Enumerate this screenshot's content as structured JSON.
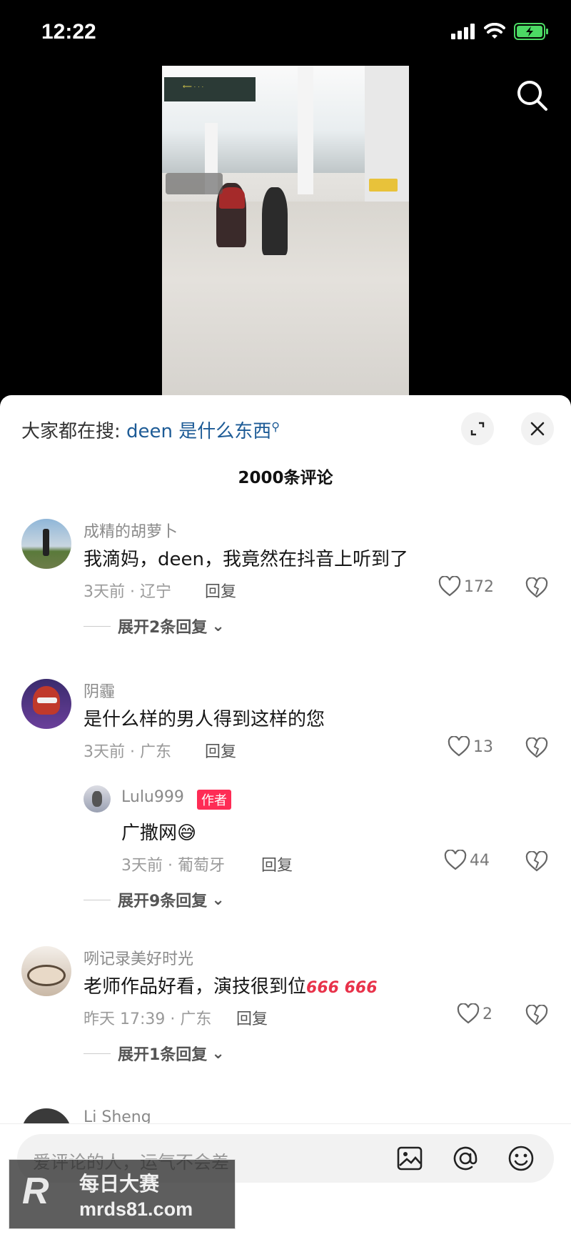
{
  "status": {
    "time": "12:22"
  },
  "trending": {
    "prefix": "大家都在搜: ",
    "query": "deen 是什么东西"
  },
  "comments_header": {
    "count_label": "2000条评论"
  },
  "comments": [
    {
      "username": "成精的胡萝卜",
      "text": "我滴妈，deen，我竟然在抖音上听到了",
      "meta": "3天前 · 辽宁",
      "reply": "回复",
      "likes": "172",
      "expand": "展开2条回复"
    },
    {
      "username": "阴霾",
      "text": "是什么样的男人得到这样的您",
      "meta": "3天前 · 广东",
      "reply": "回复",
      "likes": "13"
    },
    {
      "username": "Lulu999",
      "author_tag": "作者",
      "text": "广撒网😅",
      "meta": "3天前 · 葡萄牙",
      "reply": "回复",
      "likes": "44",
      "expand": "展开9条回复"
    },
    {
      "username": "咧记录美好时光",
      "text": "老师作品好看，演技很到位",
      "emoji": "666 666",
      "meta": "昨天 17:39 · 广东",
      "reply": "回复",
      "likes": "2",
      "expand": "展开1条回复"
    },
    {
      "username": "Li Sheng"
    }
  ],
  "input": {
    "placeholder": "爱评论的人，运气不会差"
  },
  "watermark": {
    "logo": "R",
    "title": "每日大赛",
    "url": "mrds81.com"
  },
  "colors": {
    "accent": "#fe2c55",
    "query": "#1d5b96"
  },
  "icons": [
    "search-icon",
    "expand-icon",
    "close-icon",
    "heart-icon",
    "broken-heart-icon",
    "image-icon",
    "at-icon",
    "emoji-icon"
  ]
}
